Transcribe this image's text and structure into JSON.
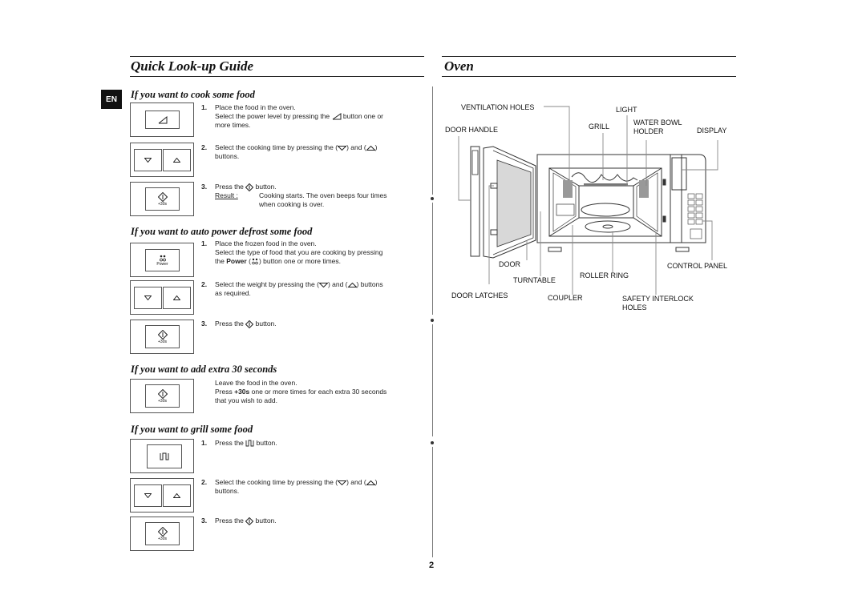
{
  "page": {
    "language_tab": "EN",
    "page_number": "2"
  },
  "left": {
    "title": "Quick Look-up Guide",
    "sections": [
      {
        "heading": "If you want to cook some food",
        "steps": [
          {
            "num": "1.",
            "line1": "Place the food in the oven.",
            "line2a": "Select the power level by pressing the",
            "line2b": "button one or",
            "line3": "more times."
          },
          {
            "num": "2.",
            "line1a": "Select the cooking time by pressing the (",
            "line1b": ") and (",
            "line1c": ")",
            "line2": "buttons."
          },
          {
            "num": "3.",
            "line1a": "Press the",
            "line1b": "button.",
            "result_label": "Result :",
            "result_line1": "Cooking starts. The oven beeps four times",
            "result_line2": "when cooking is over."
          }
        ],
        "button_labels": {
          "start": "+30s"
        }
      },
      {
        "heading": "If you want to auto power defrost some food",
        "steps": [
          {
            "num": "1.",
            "line1": "Place the frozen food in the oven.",
            "line2": "Select the type of food that you are cooking by pressing",
            "line3a": "the",
            "line3_bold": "Power",
            "line3b": "(",
            "line3c": ") button one or more times."
          },
          {
            "num": "2.",
            "line1a": "Select the weight by pressing the (",
            "line1b": ") and (",
            "line1c": ") buttons",
            "line2": "as required."
          },
          {
            "num": "3.",
            "line1a": "Press the",
            "line1b": "button."
          }
        ],
        "button_labels": {
          "power": "Power",
          "start": "+30s"
        }
      },
      {
        "heading": "If you want to add extra 30 seconds",
        "text": {
          "line1": "Leave the food in the oven.",
          "line2a": "Press",
          "line2_bold": "+30s",
          "line2b": "one or more times for each extra 30 seconds",
          "line3": "that you wish to add."
        },
        "button_labels": {
          "start": "+30s"
        }
      },
      {
        "heading": "If you want to grill some food",
        "steps": [
          {
            "num": "1.",
            "line1a": "Press the",
            "line1b": "button."
          },
          {
            "num": "2.",
            "line1a": "Select the cooking time by pressing the (",
            "line1b": ") and (",
            "line1c": ")",
            "line2": "buttons."
          },
          {
            "num": "3.",
            "line1a": "Press the",
            "line1b": "button."
          }
        ],
        "button_labels": {
          "start": "+30s"
        }
      }
    ]
  },
  "right": {
    "title": "Oven",
    "labels": {
      "ventilation_holes": "VENTILATION HOLES",
      "light": "LIGHT",
      "door_handle": "DOOR HANDLE",
      "grill": "GRILL",
      "water_bowl_holder_1": "WATER BOWL",
      "water_bowl_holder_2": "HOLDER",
      "display": "DISPLAY",
      "door": "DOOR",
      "control_panel": "CONTROL PANEL",
      "turntable": "TURNTABLE",
      "roller_ring": "ROLLER RING",
      "door_latches": "DOOR LATCHES",
      "coupler": "COUPLER",
      "safety_interlock_1": "SAFETY INTERLOCK",
      "safety_interlock_2": "HOLES"
    }
  }
}
